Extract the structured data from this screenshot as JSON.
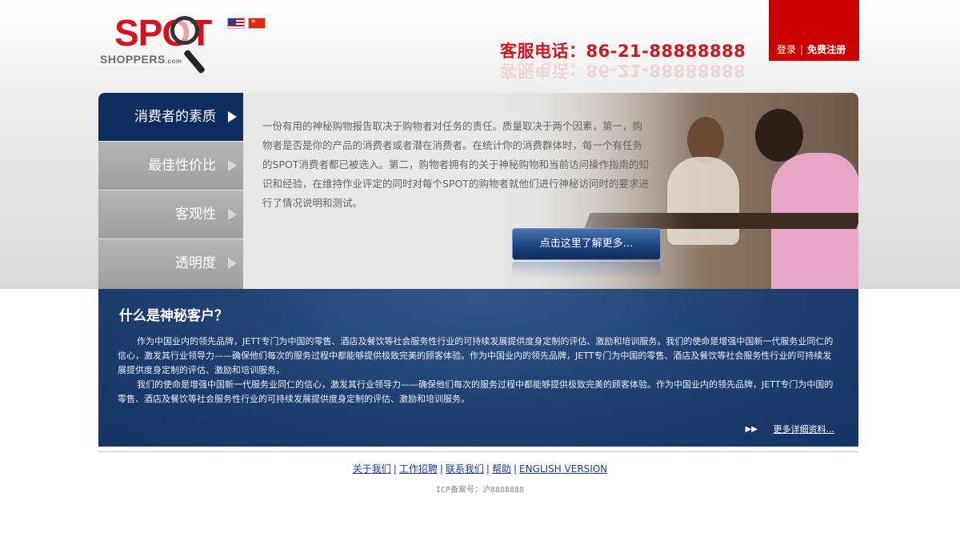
{
  "header": {
    "logo_main": "SPOT",
    "logo_sub": "SHOPPERS",
    "logo_domain": ".com",
    "hotline": "客服电话：86-21-88888888",
    "login": "登录",
    "login_separator": "|",
    "register": "免费注册"
  },
  "flags": [
    "us-flag-icon",
    "cn-flag-icon"
  ],
  "menu": {
    "items": [
      {
        "label": "消费者的素质",
        "active": true
      },
      {
        "label": "最佳性价比",
        "active": false
      },
      {
        "label": "客观性",
        "active": false
      },
      {
        "label": "透明度",
        "active": false
      }
    ]
  },
  "banner": {
    "text": "一份有用的神秘购物报告取决于购物者对任务的责任。质量取决于两个因素，第一，购物者是否是你的产品的消费者或者潜在消费者。在统计你的消费群体时，每一个有任务的SPOT消费者都已被选入。第二，购物者拥有的关于神秘购物和当前访问操作指南的知识和经验，在维持作业评定的同时对每个SPOT的购物者就他们进行神秘访问时的要求进行了情况说明和测试。",
    "button": "点击这里了解更多..."
  },
  "info": {
    "title": "什么是神秘客户？",
    "paragraph_1": "作为中国业内的领先品牌，JETT专门为中国的零售、酒店及餐饮等社会服务性行业的可持续发展提供度身定制的评估、激励和培训服务。我们的使命是增强中国新一代服务业同仁的信心，激发其行业领导力——确保他们每次的服务过程中都能够提供极致完美的顾客体验。作为中国业内的领先品牌，JETT专门为中国的零售、酒店及餐饮等社会服务性行业的可持续发展提供度身定制的评估、激励和培训服务。",
    "paragraph_2": "我们的使命是增强中国新一代服务业同仁的信心，激发其行业领导力——确保他们每次的服务过程中都能够提供极致完美的顾客体验。作为中国业内的领先品牌，JETT专门为中国的零售、酒店及餐饮等社会服务性行业的可持续发展提供度身定制的评估、激励和培训服务。",
    "more": "更多详细资料..."
  },
  "footer": {
    "links": [
      "关于我们",
      "工作招聘",
      "联系我们",
      "帮助",
      "ENGLISH VERSION"
    ],
    "separator": "|",
    "icp": "ICP备案号：沪8888888"
  },
  "colors": {
    "brand_red": "#cc0000",
    "navy": "#0e2c5c",
    "info_blue": "#1e3f70",
    "link_blue": "#1c3e8a"
  }
}
